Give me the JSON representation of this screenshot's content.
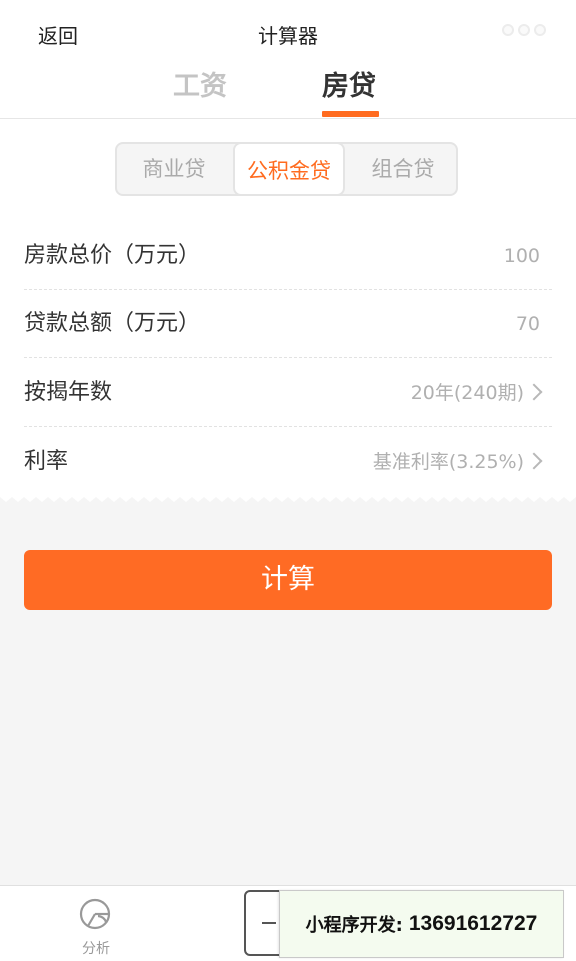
{
  "nav": {
    "back_label": "返回",
    "title": "计算器"
  },
  "tabs": [
    {
      "label": "工资",
      "active": false
    },
    {
      "label": "房贷",
      "active": true
    }
  ],
  "loan_type": {
    "options": [
      "商业贷",
      "公积金贷",
      "组合贷"
    ],
    "selected": "公积金贷"
  },
  "form": {
    "rows": [
      {
        "label": "房款总价（万元）",
        "value": "100"
      },
      {
        "label": "贷款总额（万元）",
        "value": "70"
      },
      {
        "label": "按揭年数",
        "value": "20年(240期)"
      },
      {
        "label": "利率",
        "value": "基准利率(3.25%)"
      }
    ]
  },
  "calculate_label": "计算",
  "bottom": {
    "analysis_label": "分析"
  },
  "promo": {
    "label": "小程序开发:",
    "phone": "13691612727"
  },
  "colors": {
    "accent": "#ff6b24",
    "muted_text": "#b0b0b0"
  }
}
